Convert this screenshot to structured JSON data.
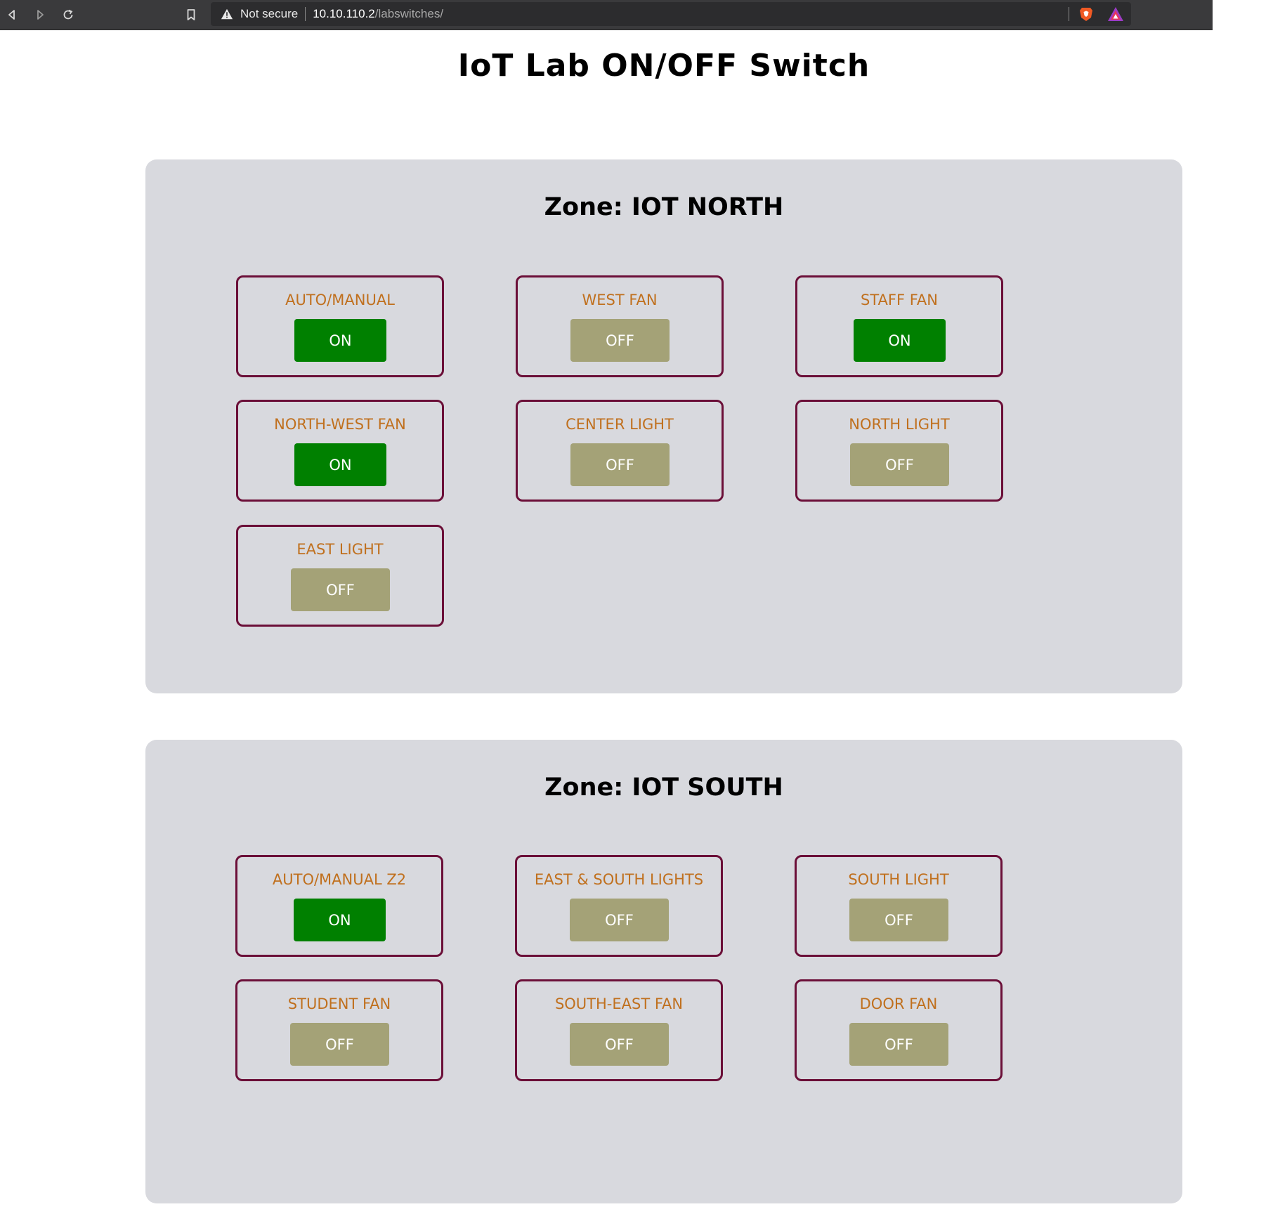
{
  "browser": {
    "security_label": "Not secure",
    "url_host": "10.10.110.2",
    "url_path": "/labswitches/"
  },
  "page": {
    "title": "IoT Lab ON/OFF Switch"
  },
  "colors": {
    "on": "#008000",
    "off": "#a4a277",
    "card_border": "#6b0f38",
    "label": "#c0701e",
    "zone_bg": "#d8d9de"
  },
  "zones": [
    {
      "title": "Zone: IOT NORTH",
      "switches": [
        {
          "label": "AUTO/MANUAL",
          "state": "ON"
        },
        {
          "label": "WEST FAN",
          "state": "OFF"
        },
        {
          "label": "STAFF FAN",
          "state": "ON"
        },
        {
          "label": "NORTH-WEST FAN",
          "state": "ON"
        },
        {
          "label": "CENTER LIGHT",
          "state": "OFF"
        },
        {
          "label": "NORTH LIGHT",
          "state": "OFF"
        },
        {
          "label": "EAST LIGHT",
          "state": "OFF"
        }
      ]
    },
    {
      "title": "Zone: IOT SOUTH",
      "switches": [
        {
          "label": "AUTO/MANUAL Z2",
          "state": "ON"
        },
        {
          "label": "EAST & SOUTH LIGHTS",
          "state": "OFF"
        },
        {
          "label": "SOUTH LIGHT",
          "state": "OFF"
        },
        {
          "label": "STUDENT FAN",
          "state": "OFF"
        },
        {
          "label": "SOUTH-EAST FAN",
          "state": "OFF"
        },
        {
          "label": "DOOR FAN",
          "state": "OFF"
        }
      ]
    }
  ]
}
